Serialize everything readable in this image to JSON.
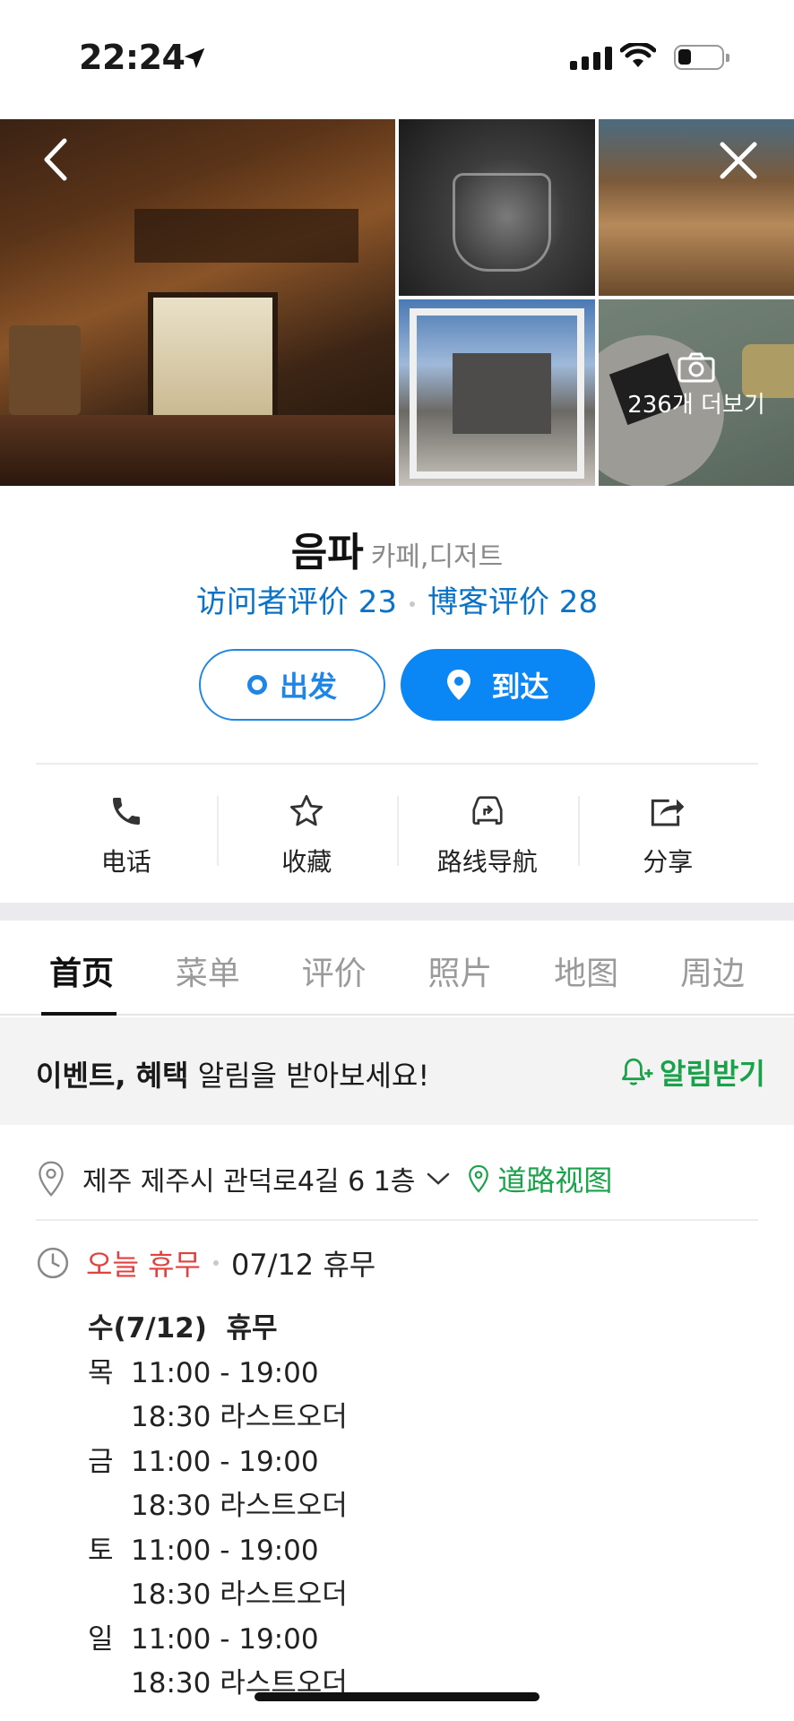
{
  "status_bar": {
    "time": "22:24"
  },
  "gallery": {
    "more_photos_label": "236개 더보기"
  },
  "place": {
    "name": "음파",
    "category": "카페,디저트",
    "visitor_reviews": "访问者评价 23",
    "blog_reviews": "博客评价 28"
  },
  "route_buttons": {
    "depart": "出发",
    "arrive": "到达"
  },
  "actions": {
    "call": "电话",
    "save": "收藏",
    "navigate": "路线导航",
    "share": "分享"
  },
  "tabs": [
    {
      "label": "首页"
    },
    {
      "label": "菜单"
    },
    {
      "label": "评价"
    },
    {
      "label": "照片"
    },
    {
      "label": "地图"
    },
    {
      "label": "周边"
    }
  ],
  "notice": {
    "bold": "이벤트, 혜택",
    "text": " 알림을 받아보세요!",
    "button": "알림받기"
  },
  "address": {
    "text": "제주 제주시 관덕로4길 6 1층",
    "street_view": "道路视图"
  },
  "hours": {
    "today_status": "오늘 휴무",
    "today_date": "07/12 휴무",
    "rows": [
      {
        "day": "수(7/12)",
        "time": "휴무"
      },
      {
        "day": "목",
        "time": "11:00 - 19:00",
        "note": "18:30 라스트오더"
      },
      {
        "day": "금",
        "time": "11:00 - 19:00",
        "note": "18:30 라스트오더"
      },
      {
        "day": "토",
        "time": "11:00 - 19:00",
        "note": "18:30 라스트오더"
      },
      {
        "day": "일",
        "time": "11:00 - 19:00",
        "note": "18:30 라스트오더"
      }
    ]
  },
  "colors": {
    "accent_blue": "#0a86f5",
    "link_blue": "#0b73c7",
    "green": "#1aa24a",
    "closed_red": "#e0423f"
  }
}
